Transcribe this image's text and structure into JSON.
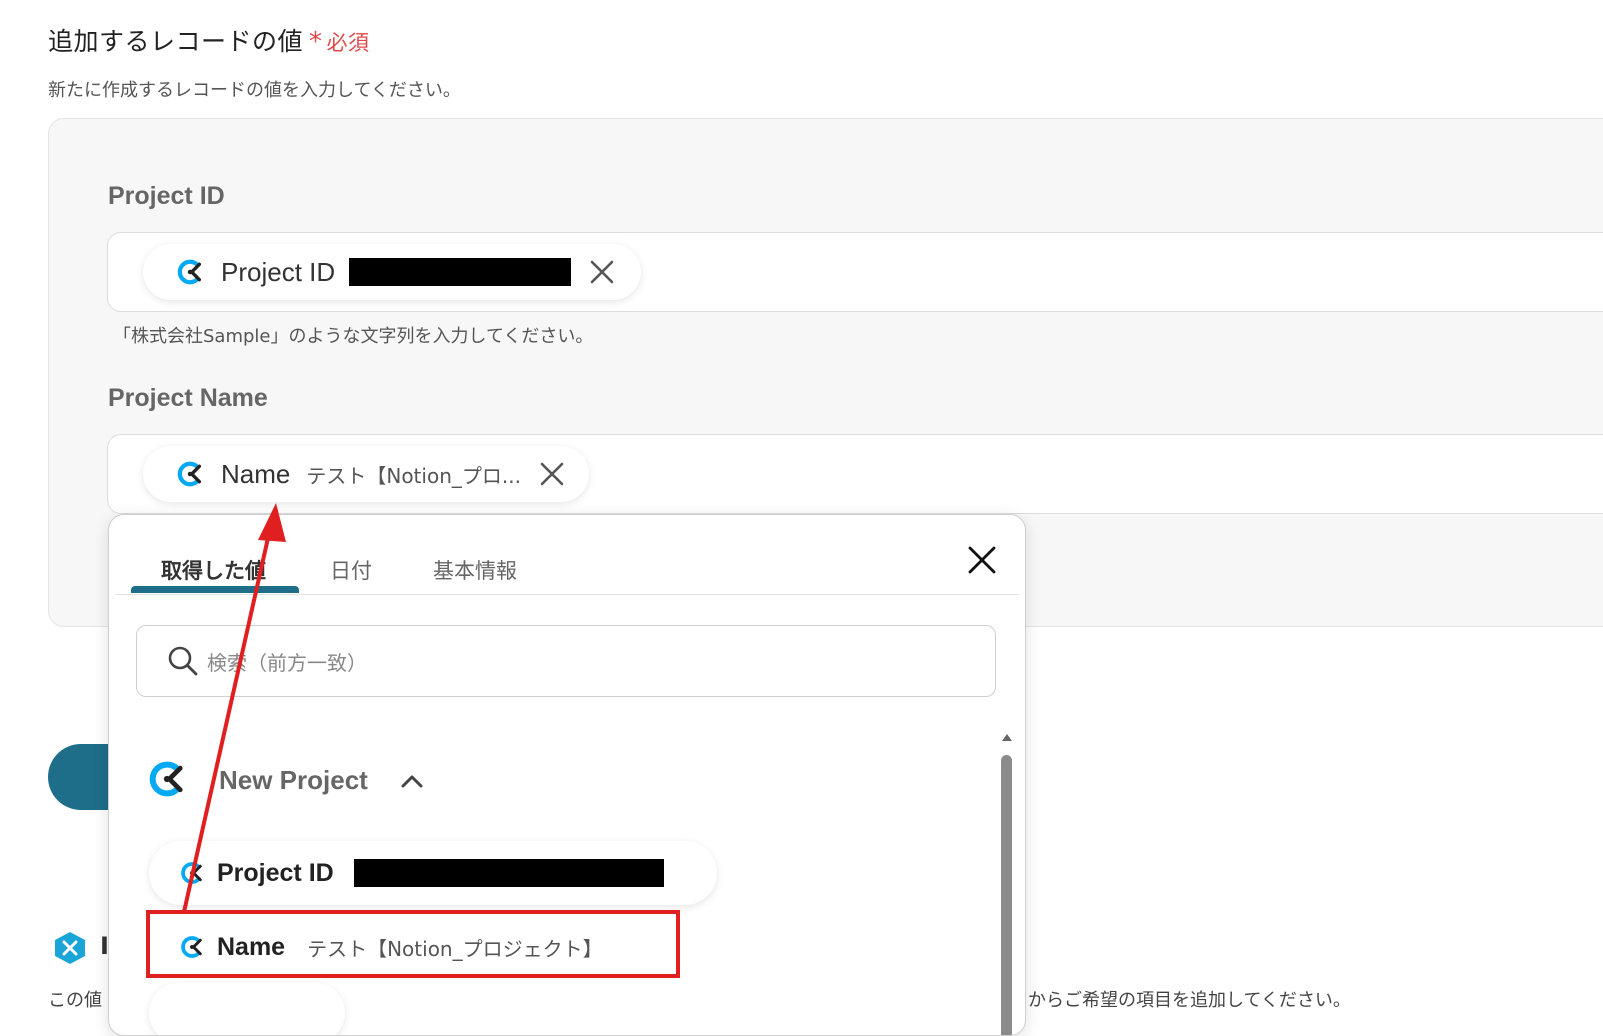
{
  "section": {
    "title": "追加するレコードの値",
    "required_mark": "*",
    "required_label": "必須",
    "description": "新たに作成するレコードの値を入力してください。"
  },
  "fields": [
    {
      "label": "Project ID",
      "chip_key": "Project ID",
      "chip_value_redacted": true,
      "hint": "「株式会社Sample」のような文字列を入力してください。"
    },
    {
      "label": "Project Name",
      "chip_key": "Name",
      "chip_value": "テスト【Notion_プロ..."
    }
  ],
  "background": {
    "footer_left": "この値",
    "footer_right": "からご希望の項目を追加してください。"
  },
  "popup": {
    "tabs": [
      {
        "label": "取得した値",
        "active": true
      },
      {
        "label": "日付",
        "active": false
      },
      {
        "label": "基本情報",
        "active": false
      }
    ],
    "search_placeholder": "検索（前方一致）",
    "group": {
      "title": "New Project",
      "expanded": true,
      "items": [
        {
          "key": "Project ID",
          "value_redacted": true
        },
        {
          "key": "Name",
          "value": "テスト【Notion_プロジェクト】",
          "highlighted": true
        }
      ]
    }
  },
  "icons": {
    "app_logo": "clockify-logo-icon",
    "close": "close-icon",
    "search": "search-icon",
    "chevron": "chevron-up-icon",
    "badge": "x-badge-icon"
  },
  "colors": {
    "accent": "#1e6e8a",
    "required": "#e04a4a",
    "annotation": "#e02020",
    "logo_blue": "#03a9f4"
  }
}
